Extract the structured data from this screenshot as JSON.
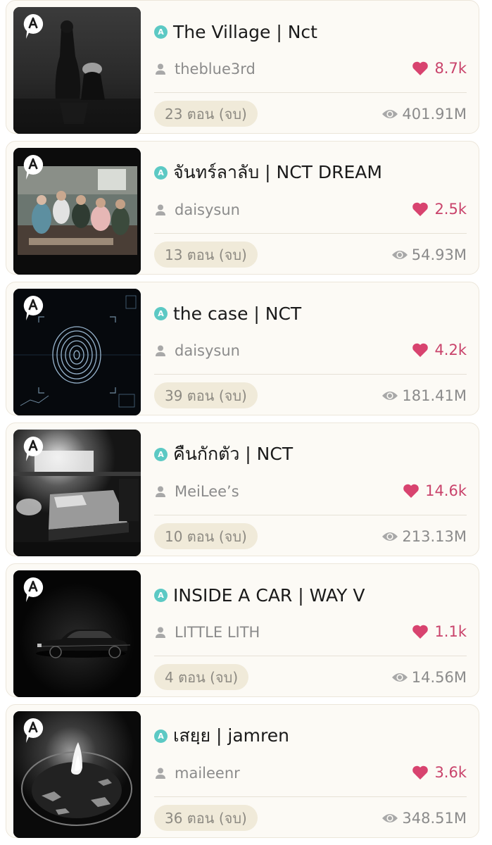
{
  "badge_letter": "A",
  "colors": {
    "title_icon": "#5cc9c4",
    "likes": "#c9436b",
    "card_background": "#fcfaf5",
    "episode_pill": "#f0ead9",
    "meta_text": "#8b8b8b"
  },
  "stories": [
    {
      "title": "The Village | Nct",
      "author": "theblue3rd",
      "likes": "8.7k",
      "episodes": "23 ตอน (จบ)",
      "views": "401.91M",
      "cover": "misty-lake-figure"
    },
    {
      "title": "จันทร์ลาลับ | NCT DREAM",
      "author": "daisysun",
      "likes": "2.5k",
      "episodes": "13 ตอน (จบ)",
      "views": "54.93M",
      "cover": "group-photo-room"
    },
    {
      "title": "the case | NCT",
      "author": "daisysun",
      "likes": "4.2k",
      "episodes": "39 ตอน (จบ)",
      "views": "181.41M",
      "cover": "fingerprint-scan"
    },
    {
      "title": "คืนกักตัว | NCT",
      "author": "MeiLee’s",
      "likes": "14.6k",
      "episodes": "10 ตอน (จบ)",
      "views": "213.13M",
      "cover": "hospital-bed"
    },
    {
      "title": "INSIDE A CAR | WAY V",
      "author": "LITTLE LITH",
      "likes": "1.1k",
      "episodes": "4 ตอน (จบ)",
      "views": "14.56M",
      "cover": "black-car"
    },
    {
      "title": "เสยฺย | jamren",
      "author": "maileenr",
      "likes": "3.6k",
      "episodes": "36 ตอน (จบ)",
      "views": "348.51M",
      "cover": "candle-flame"
    }
  ]
}
